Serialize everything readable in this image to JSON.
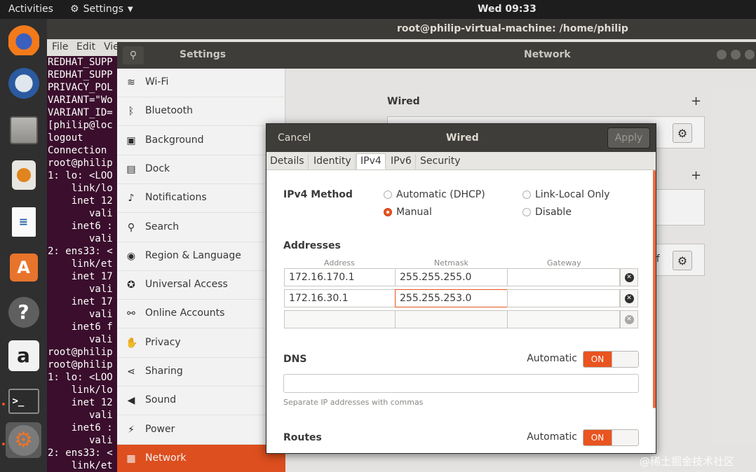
{
  "topbar": {
    "activities": "Activities",
    "app_menu": "Settings",
    "clock": "Wed 09:33"
  },
  "dock": {
    "apps": [
      "firefox-icon",
      "thunderbird-icon",
      "files-icon",
      "rhythmbox-icon",
      "libreoffice-writer-icon",
      "software-icon",
      "help-icon",
      "amazon-icon",
      "terminal-icon",
      "settings-icon"
    ]
  },
  "terminal": {
    "title": "root@philip-virtual-machine: /home/philip",
    "menu": [
      "File",
      "Edit",
      "Vie"
    ],
    "lines": [
      "REDHAT_SUPP",
      "REDHAT_SUPP",
      "PRIVACY_POL",
      "VARIANT=\"Wo",
      "VARIANT_ID=",
      "[philip@loc",
      "logout",
      "Connection ",
      "root@philip",
      "1: lo: <LOO",
      "    link/lo",
      "    inet 12",
      "       vali",
      "    inet6 :",
      "       vali",
      "2: ens33: <",
      "    link/et",
      "    inet 17",
      "       vali",
      "    inet 17",
      "       vali",
      "    inet6 f",
      "       vali",
      "root@philip",
      "root@philip",
      "1: lo: <LOO",
      "    link/lo",
      "    inet 12",
      "       vali",
      "    inet6 :",
      "       vali",
      "2: ens33: <",
      "    link/et"
    ]
  },
  "settings": {
    "title_left": "Settings",
    "title_right": "Network",
    "sidebar": [
      {
        "label": "Wi-Fi",
        "icon": "wifi-icon",
        "glyph": "≋"
      },
      {
        "label": "Bluetooth",
        "icon": "bluetooth-icon",
        "glyph": "ᛒ"
      },
      {
        "label": "Background",
        "icon": "background-icon",
        "glyph": "▣"
      },
      {
        "label": "Dock",
        "icon": "dock-icon",
        "glyph": "▤"
      },
      {
        "label": "Notifications",
        "icon": "notifications-icon",
        "glyph": "♪"
      },
      {
        "label": "Search",
        "icon": "search-icon",
        "glyph": "⚲"
      },
      {
        "label": "Region & Language",
        "icon": "region-icon",
        "glyph": "◉"
      },
      {
        "label": "Universal Access",
        "icon": "universal-access-icon",
        "glyph": "✪"
      },
      {
        "label": "Online Accounts",
        "icon": "online-accounts-icon",
        "glyph": "⚯"
      },
      {
        "label": "Privacy",
        "icon": "privacy-icon",
        "glyph": "✋"
      },
      {
        "label": "Sharing",
        "icon": "sharing-icon",
        "glyph": "⋖"
      },
      {
        "label": "Sound",
        "icon": "sound-icon",
        "glyph": "◀"
      },
      {
        "label": "Power",
        "icon": "power-icon",
        "glyph": "⚡"
      },
      {
        "label": "Network",
        "icon": "network-icon",
        "glyph": "▦"
      }
    ],
    "selected_index": 13,
    "network": {
      "wired_heading": "Wired",
      "off_fragment": "ff"
    }
  },
  "dialog": {
    "cancel": "Cancel",
    "title": "Wired",
    "apply": "Apply",
    "tabs": [
      "Details",
      "Identity",
      "IPv4",
      "IPv6",
      "Security"
    ],
    "active_tab": "IPv4",
    "ipv4_method_label": "IPv4 Method",
    "methods": [
      {
        "label": "Automatic (DHCP)",
        "selected": false
      },
      {
        "label": "Link-Local Only",
        "selected": false
      },
      {
        "label": "Manual",
        "selected": true
      },
      {
        "label": "Disable",
        "selected": false
      }
    ],
    "addresses_label": "Addresses",
    "columns": [
      "Address",
      "Netmask",
      "Gateway"
    ],
    "rows": [
      {
        "address": "172.16.170.1",
        "netmask": "255.255.255.0",
        "gateway": ""
      },
      {
        "address": "172.16.30.1",
        "netmask": "255.255.253.0",
        "gateway": ""
      },
      {
        "address": "",
        "netmask": "",
        "gateway": ""
      }
    ],
    "dns_label": "DNS",
    "dns_automatic_label": "Automatic",
    "dns_switch": "ON",
    "dns_value": "",
    "dns_hint": "Separate IP addresses with commas",
    "routes_label": "Routes",
    "routes_automatic_label": "Automatic",
    "routes_switch": "ON"
  },
  "watermark": "@稀土掘金技术社区",
  "colors": {
    "accent": "#e95420",
    "header": "#3e3d39",
    "terminal_bg": "#3a0e2c"
  }
}
